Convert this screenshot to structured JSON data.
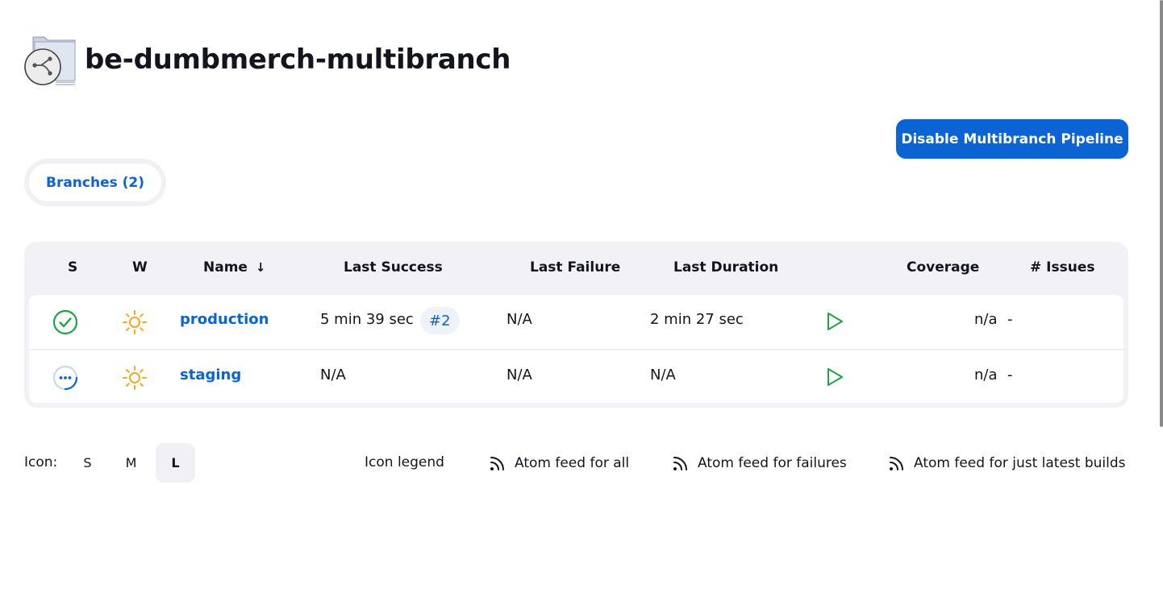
{
  "job": {
    "title": "be-dumbmerch-multibranch",
    "icon": "multibranch-folder-icon"
  },
  "actions": {
    "disable_label": "Disable Multibranch Pipeline"
  },
  "tabs": [
    {
      "label": "Branches (2)",
      "active": true
    }
  ],
  "table": {
    "headers": {
      "s": "S",
      "w": "W",
      "name": "Name",
      "name_sort": "↓",
      "last_success": "Last Success",
      "last_failure": "Last Failure",
      "last_duration": "Last Duration",
      "coverage": "Coverage",
      "issues": "# Issues"
    },
    "rows": [
      {
        "status": "success-icon",
        "weather": "sunny-icon",
        "name": "production",
        "last_success": "5 min 39 sec",
        "build": "#2",
        "last_failure": "N/A",
        "last_duration": "2 min 27 sec",
        "coverage": "n/a",
        "issues": "-"
      },
      {
        "status": "in-progress-icon",
        "weather": "sunny-icon",
        "name": "staging",
        "last_success": "N/A",
        "build": "",
        "last_failure": "N/A",
        "last_duration": "N/A",
        "coverage": "n/a",
        "issues": "-"
      }
    ]
  },
  "footer": {
    "icon_label": "Icon:",
    "sizes": [
      "S",
      "M",
      "L"
    ],
    "active_size": "L",
    "legend": "Icon legend",
    "feed_all": "Atom feed for all",
    "feed_failures": "Atom feed for failures",
    "feed_latest": "Atom feed for just latest builds"
  },
  "colors": {
    "accent": "#0b63d4",
    "success": "#1ea446",
    "weather": "#f5a623",
    "table_bg": "#f2f2f6"
  }
}
